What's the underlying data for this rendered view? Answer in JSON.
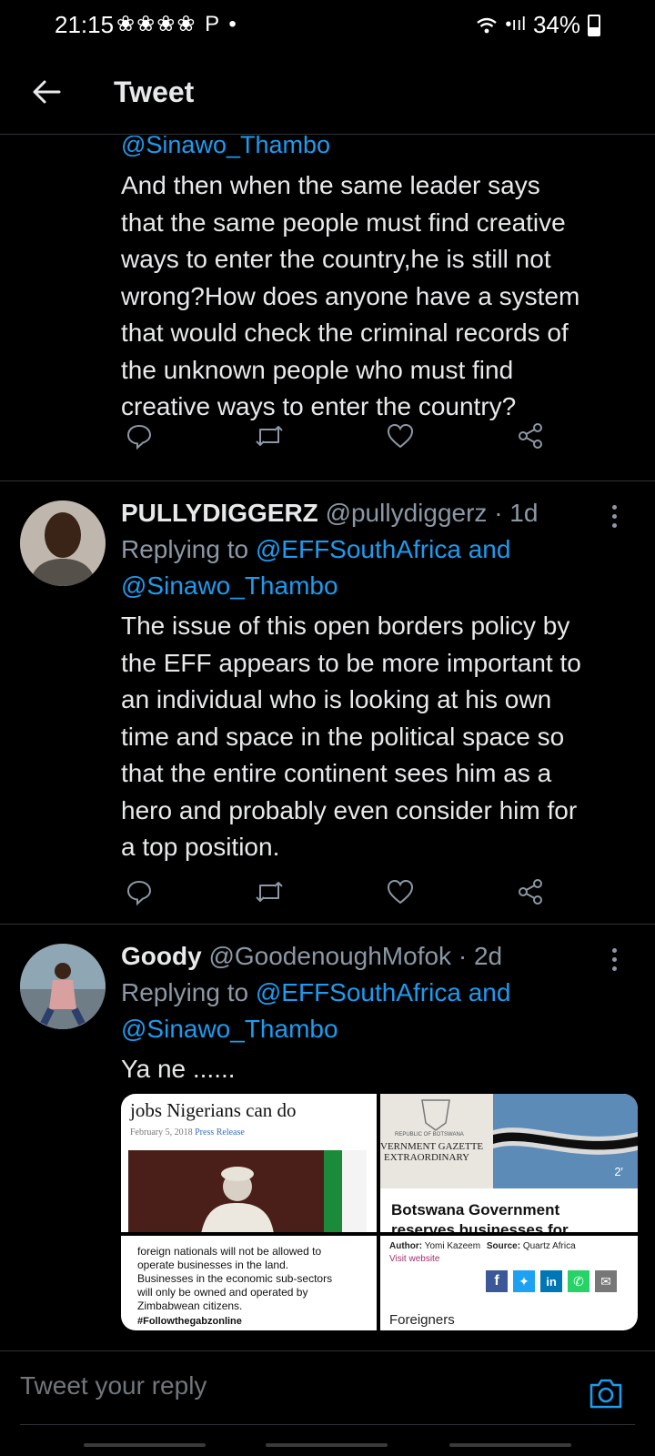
{
  "status_bar": {
    "time": "21:15",
    "notification_icons": "❀❀❀❀ P •",
    "signal": "•ııl",
    "battery": "34%"
  },
  "header": {
    "title": "Tweet"
  },
  "tweets": [
    {
      "handle_line": "@Sinawo_Thambo",
      "text": "And then when the same leader says\nthat the same people must find creative\nways to enter the country,he is still not\nwrong?How does anyone have a system\nthat would check the criminal records of\nthe unknown people who must find\ncreative ways to enter the country?"
    },
    {
      "name": "PULLYDIGGERZ",
      "handle": "@pullydiggerz",
      "time": "· 1d",
      "replying_prefix": "Replying to",
      "replying_to": "@EFFSouthAfrica and",
      "replying_to_2": "@Sinawo_Thambo",
      "text": "The issue of this open borders policy by\nthe EFF appears to be more important to\nan individual who is looking at his own\ntime and space in the political space so\nthat the entire continent sees him as a\nhero and probably even consider him for\na top position."
    },
    {
      "name": "Goody",
      "handle": "@GoodenoughMofok",
      "time": "· 2d",
      "replying_prefix": "Replying to",
      "replying_to": "@EFFSouthAfrica and",
      "replying_to_2": "@Sinawo_Thambo",
      "text": "Ya ne ......",
      "media": {
        "img1_headline": "jobs Nigerians can do",
        "img1_date": "February 5, 2018",
        "img1_category": "Press Release",
        "img2_top": "REPUBLIC OF BOTSWANA",
        "img2_gazette": "VERNMENT GAZETTE",
        "img2_extra": "EXTRAORDINARY",
        "img2_counter": "2′",
        "img2_title": "Botswana Government",
        "img2_title2": "reserves businesses for",
        "img3_text": "foreign nationals will not be allowed to\noperate businesses in the land.\nBusinesses in the economic sub-sectors\nwill only be owned and operated by\nZimbabwean citizens.",
        "img3_tag": "#Followthegabzonline",
        "img4_author_label": "Author:",
        "img4_author": "Yomi Kazeem",
        "img4_source_label": "Source:",
        "img4_source": "Quartz Africa",
        "img4_visit": "Visit website",
        "img4_bottom": "Foreigners"
      }
    }
  ],
  "reply_bar": {
    "placeholder": "Tweet your reply"
  },
  "colors": {
    "accent": "#1d9bf0",
    "background": "#000000",
    "muted": "#8b98a5"
  }
}
